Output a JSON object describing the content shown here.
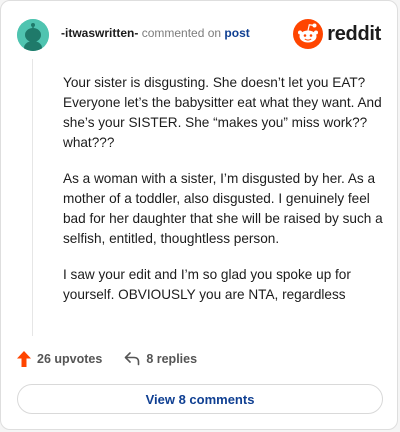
{
  "comment": {
    "username": "-itwaswritten-",
    "commented_on": "commented on",
    "post_link": "post",
    "paragraphs": [
      "Your sister is disgusting. She doesn’t let you EAT? Everyone let’s the babysitter eat what they want. And she’s your SISTER. She “makes you” miss work?? what???",
      "As a woman with a sister, I’m disgusted by her. As a mother of a toddler, also disgusted. I genuinely feel bad for her daughter that she will be raised by such a selfish, entitled, thoughtless person.",
      "I saw your edit and I’m so glad you spoke up for yourself. OBVIOUSLY you are NTA, regardless"
    ],
    "upvotes": "26 upvotes",
    "replies": "8 replies",
    "view_comments": "View 8 comments"
  },
  "brand": {
    "name": "reddit",
    "logo_icon": "reddit-snoo-icon",
    "accent": "#ff4500"
  },
  "colors": {
    "avatar_bg": "#4fc4b0",
    "link": "#0f3f92",
    "upvote": "#ff4500"
  }
}
